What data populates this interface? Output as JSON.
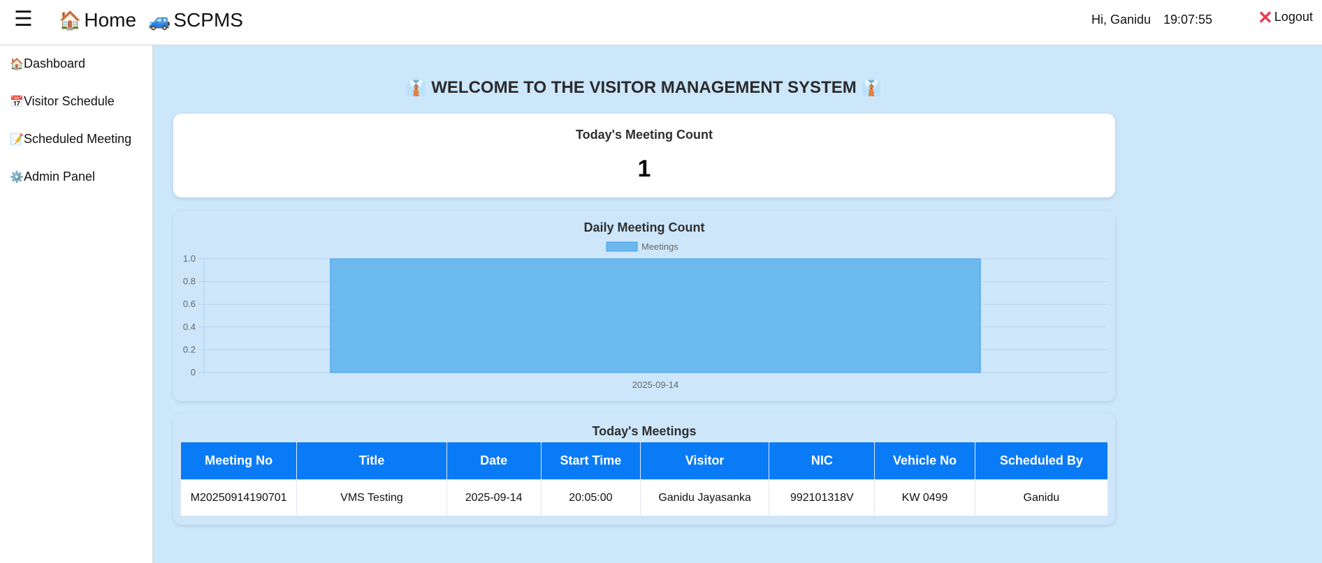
{
  "header": {
    "menu_icon": "☰",
    "home_icon": "🏠",
    "home_label": "Home",
    "app_icon": "🚙",
    "app_label": "SCPMS",
    "greeting": "Hi, Ganidu",
    "time": "19:07:55",
    "logout_icon": "✕",
    "logout_label": "Logout"
  },
  "sidebar": {
    "items": [
      {
        "icon": "🏠",
        "label": "Dashboard"
      },
      {
        "icon": "📅",
        "label": "Visitor Schedule"
      },
      {
        "icon": "📝",
        "label": "Scheduled Meeting"
      },
      {
        "icon": "⚙️",
        "label": "Admin Panel"
      }
    ]
  },
  "main": {
    "welcome_icon": "👔",
    "welcome_text": "WELCOME TO THE VISITOR MANAGEMENT SYSTEM",
    "count_card": {
      "title": "Today's Meeting Count",
      "value": "1"
    },
    "table": {
      "title": "Today's Meetings",
      "headers": [
        "Meeting No",
        "Title",
        "Date",
        "Start Time",
        "Visitor",
        "NIC",
        "Vehicle No",
        "Scheduled By"
      ],
      "rows": [
        [
          "M20250914190701",
          "VMS Testing",
          "2025-09-14",
          "20:05:00",
          "Ganidu Jayasanka",
          "992101318V",
          "KW 0499",
          "Ganidu"
        ]
      ]
    }
  },
  "chart_data": {
    "type": "bar",
    "title": "Daily Meeting Count",
    "categories": [
      "2025-09-14"
    ],
    "series": [
      {
        "name": "Meetings",
        "values": [
          1
        ]
      }
    ],
    "ylim": [
      0,
      1
    ],
    "yticks": [
      "0",
      "0.2",
      "0.4",
      "0.6",
      "0.8",
      "1.0"
    ],
    "grid": true,
    "legend": "top",
    "colors": {
      "bar_fill": "#6cb9f0",
      "bar_stroke": "#3f9ee6"
    }
  },
  "colors": {
    "accent": "#0a7bf7",
    "background": "#cce6fa",
    "logout_x": "#f0384e"
  }
}
